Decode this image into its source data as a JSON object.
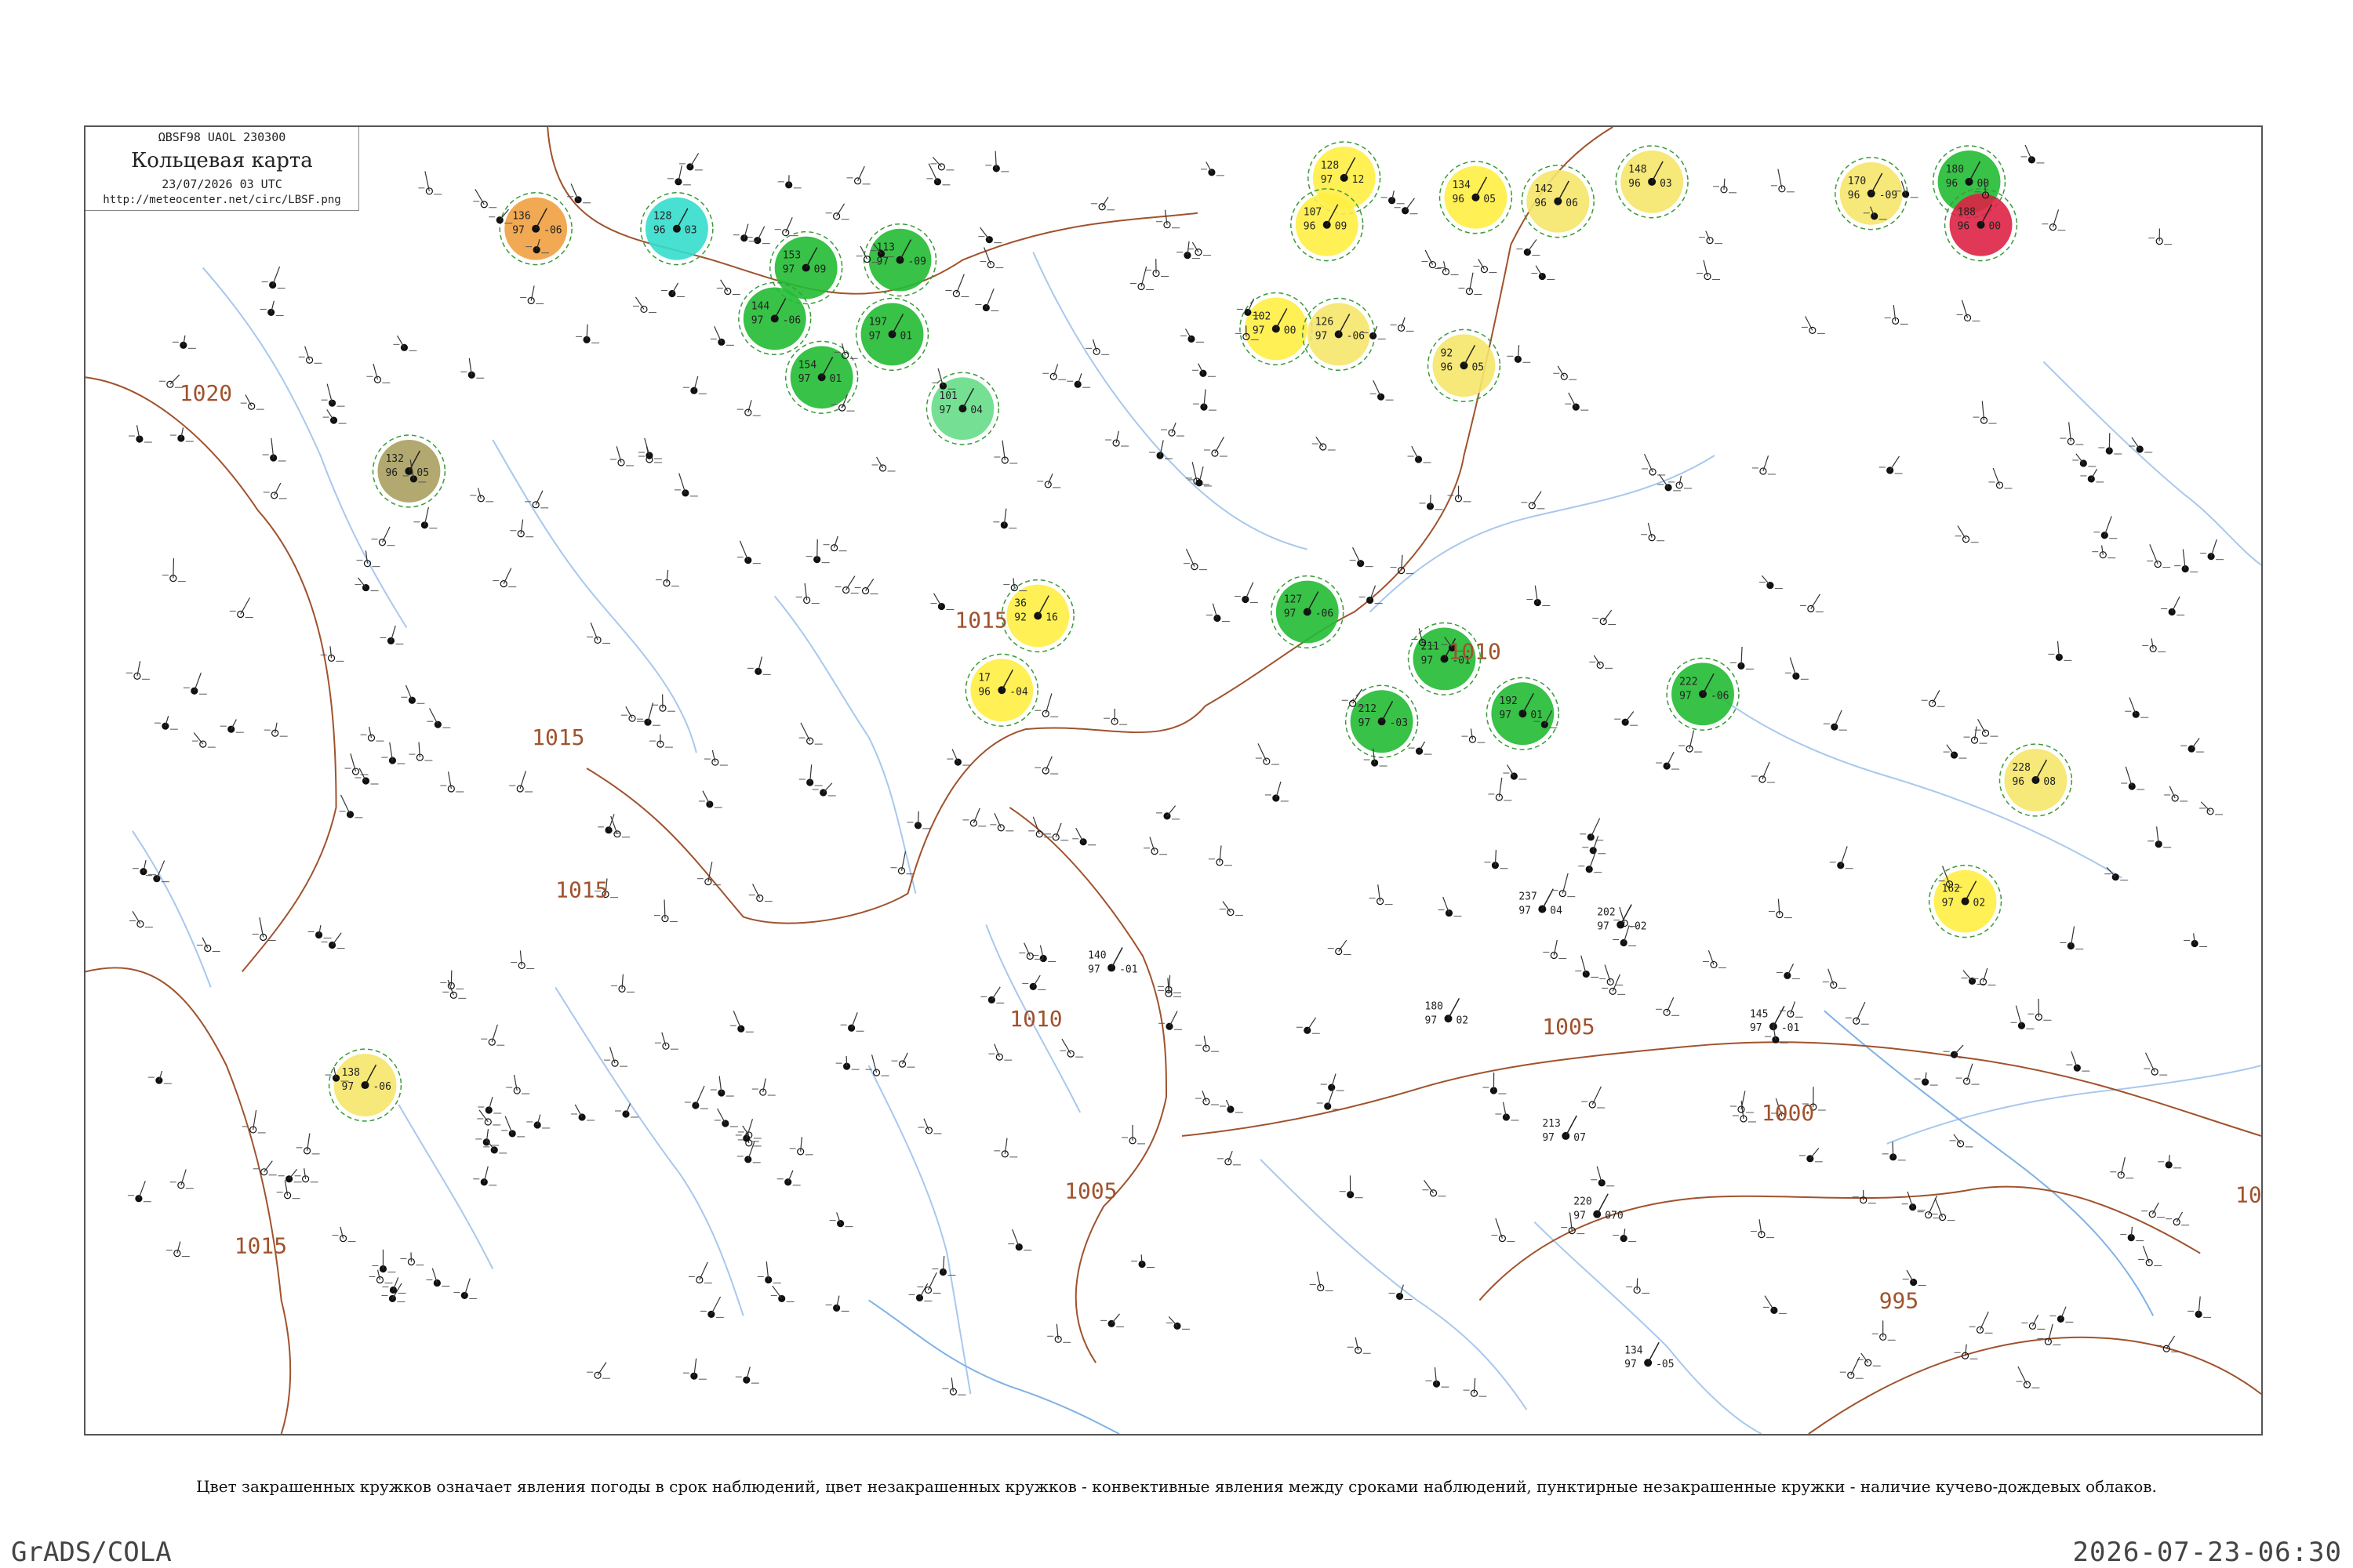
{
  "header": {
    "code": "ΩBSF98  UAOL  230300",
    "title": "Кольцевая карта",
    "date": "23/07/2026 03 UTC",
    "url": "http://meteocenter.net/circ/LBSF.png"
  },
  "isobars": [
    "1020",
    "1015",
    "1015",
    "1015",
    "1010",
    "1010",
    "1005",
    "1005",
    "1000",
    "1015",
    "995",
    "10"
  ],
  "caption": "Цвет закрашенных кружков означает явления погоды в срок наблюдений, цвет незакрашенных кружков - конвективные явления между сроками наблюдений, пунктирные незакрашенные кружки - наличие кучево-дождевых облаков.",
  "footer": {
    "left": "GrADS/COLA",
    "right": "2026-07-23-06:30"
  },
  "colors": {
    "river": "#a8c8ee",
    "coast": "#7fb2e5",
    "isobar": "#a0522d",
    "rain": "#22bb33",
    "drizzle": "#66dd88",
    "shower": "#33ddcc",
    "haze": "#ffee44",
    "fog": "#f5e66a",
    "thunder": "#dd2244",
    "dust": "#f0a040",
    "smoke": "#a8a060"
  },
  "stations": [
    {
      "p": "153",
      "t": "97",
      "v": "09",
      "c": "rain"
    },
    {
      "p": "197",
      "t": "97",
      "v": "01",
      "c": "rain"
    },
    {
      "p": "101",
      "t": "97",
      "v": "04",
      "c": "drizzle"
    },
    {
      "p": "128",
      "t": "96",
      "v": "03",
      "c": "shower"
    },
    {
      "p": "144",
      "t": "97",
      "v": "-06",
      "c": "rain"
    },
    {
      "p": "154",
      "t": "97",
      "v": "01",
      "c": "rain"
    },
    {
      "p": "113",
      "t": "97",
      "v": "-09",
      "c": "rain"
    },
    {
      "p": "128",
      "t": "97",
      "v": "12",
      "c": "haze"
    },
    {
      "p": "107",
      "t": "96",
      "v": "09",
      "c": "haze"
    },
    {
      "p": "134",
      "t": "96",
      "v": "05",
      "c": "haze"
    },
    {
      "p": "142",
      "t": "96",
      "v": "06",
      "c": "fog"
    },
    {
      "p": "148",
      "t": "96",
      "v": "03",
      "c": "fog"
    },
    {
      "p": "170",
      "t": "96",
      "v": "-09",
      "c": "fog"
    },
    {
      "p": "180",
      "t": "96",
      "v": "00",
      "c": "rain"
    },
    {
      "p": "188",
      "t": "96",
      "v": "00",
      "c": "thunder"
    },
    {
      "p": "102",
      "t": "97",
      "v": "00",
      "c": "haze"
    },
    {
      "p": "126",
      "t": "97",
      "v": "-06",
      "c": "fog"
    },
    {
      "p": "92",
      "t": "96",
      "v": "05",
      "c": "fog"
    },
    {
      "p": "36",
      "t": "92",
      "v": "16",
      "c": "haze"
    },
    {
      "p": "17",
      "t": "96",
      "v": "-04",
      "c": "haze"
    },
    {
      "p": "127",
      "t": "97",
      "v": "-06",
      "c": "rain"
    },
    {
      "p": "211",
      "t": "97",
      "v": "-01",
      "c": "rain"
    },
    {
      "p": "192",
      "t": "97",
      "v": "01",
      "c": "rain"
    },
    {
      "p": "212",
      "t": "97",
      "v": "-03",
      "c": "rain"
    },
    {
      "p": "222",
      "t": "97",
      "v": "-06",
      "c": "rain"
    },
    {
      "p": "162",
      "t": "97",
      "v": "02",
      "c": "haze"
    },
    {
      "p": "228",
      "t": "96",
      "v": "08",
      "c": "fog"
    },
    {
      "p": "138",
      "t": "97",
      "v": "-06",
      "c": "fog"
    },
    {
      "p": "132",
      "t": "96",
      "v": "05",
      "c": "smoke"
    },
    {
      "p": "136",
      "t": "97",
      "v": "-06",
      "c": "dust"
    },
    {
      "p": "237",
      "t": "97",
      "v": "04",
      "c": "plain"
    },
    {
      "p": "180",
      "t": "97",
      "v": "02",
      "c": "plain"
    },
    {
      "p": "140",
      "t": "97",
      "v": "-01",
      "c": "plain"
    },
    {
      "p": "213",
      "t": "97",
      "v": "07",
      "c": "plain"
    },
    {
      "p": "145",
      "t": "97",
      "v": "-01",
      "c": "plain"
    },
    {
      "p": "202",
      "t": "97",
      "v": "-02",
      "c": "plain"
    },
    {
      "p": "220",
      "t": "97",
      "v": "070",
      "c": "plain"
    },
    {
      "p": "134",
      "t": "97",
      "v": "-05",
      "c": "plain"
    }
  ]
}
